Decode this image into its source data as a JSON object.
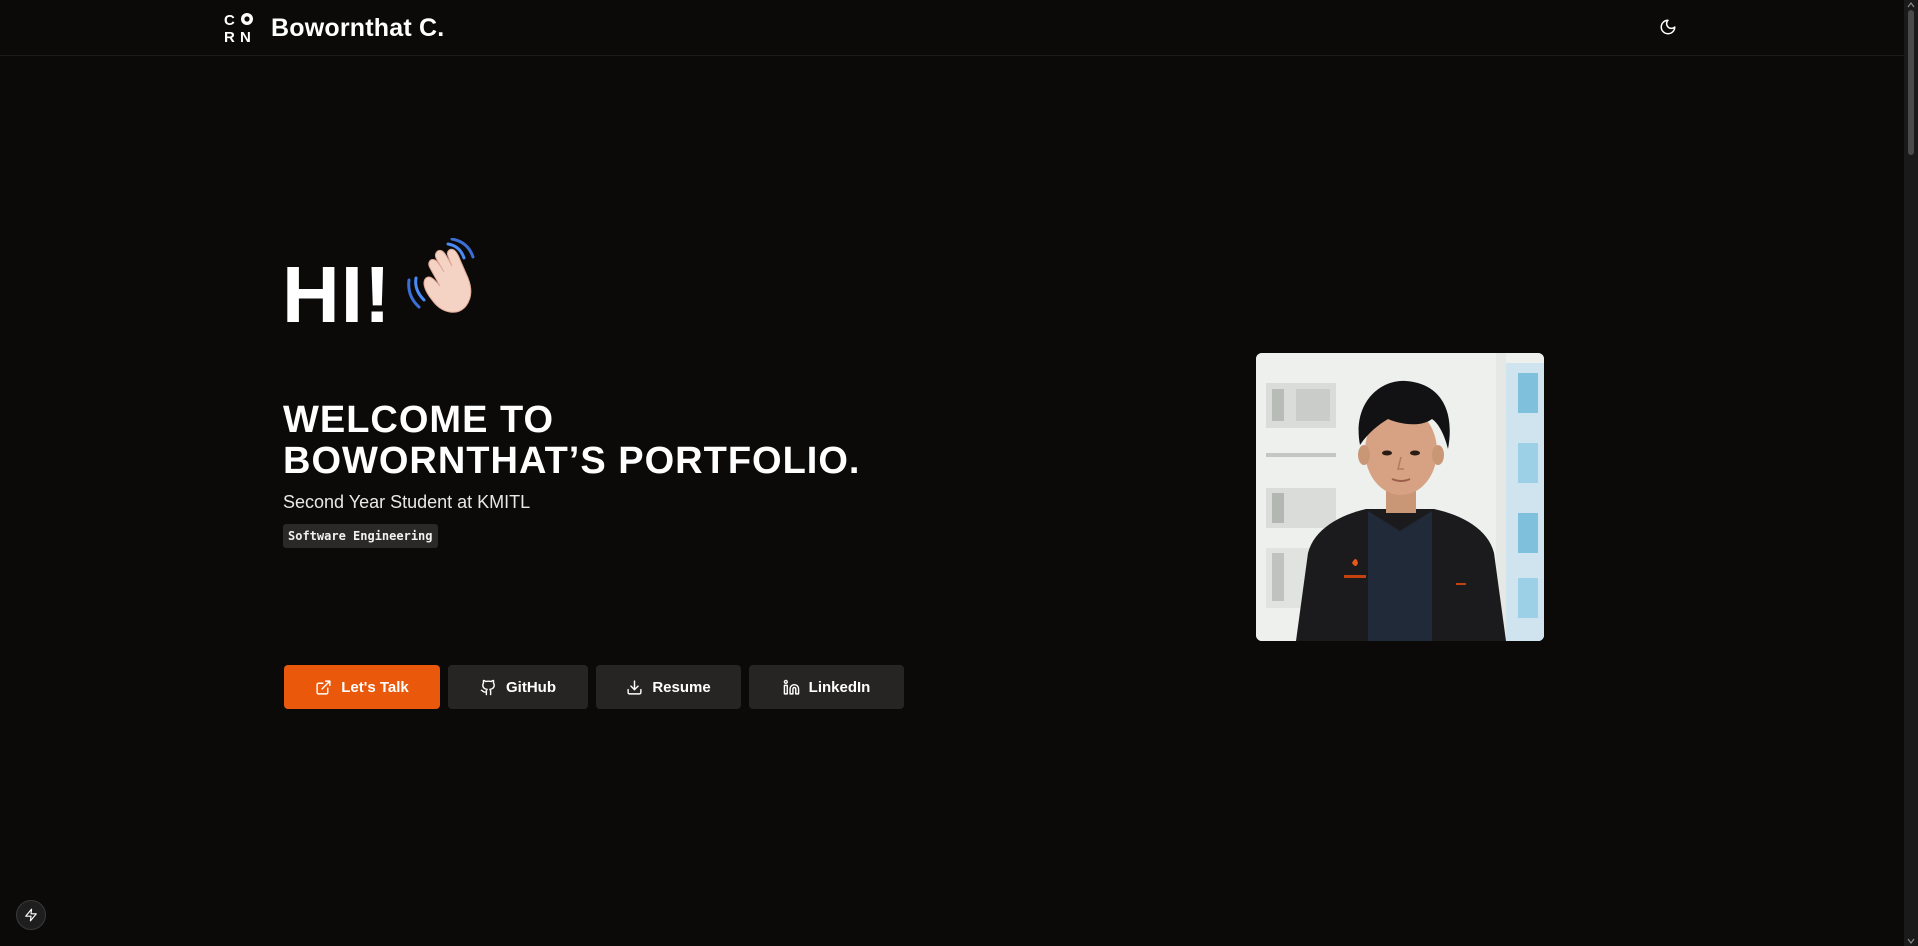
{
  "header": {
    "logo_text": "CORN",
    "brand": "Bowornthat C.",
    "theme_icon": "moon-icon"
  },
  "hero": {
    "greeting": "HI!",
    "greeting_icon": "waving-hand-icon",
    "welcome_line1": "WELCOME TO",
    "welcome_line2": "BOWORNTHAT’S PORTFOLIO.",
    "subtitle": "Second Year Student at KMITL",
    "tag": "Software Engineering"
  },
  "buttons": [
    {
      "label": "Let's Talk",
      "icon": "external-link-icon"
    },
    {
      "label": "GitHub",
      "icon": "github-icon"
    },
    {
      "label": "Resume",
      "icon": "download-icon"
    },
    {
      "label": "LinkedIn",
      "icon": "linkedin-icon"
    }
  ],
  "colors": {
    "background": "#0b0a09",
    "accent": "#ea580c",
    "button_bg": "#262524"
  }
}
